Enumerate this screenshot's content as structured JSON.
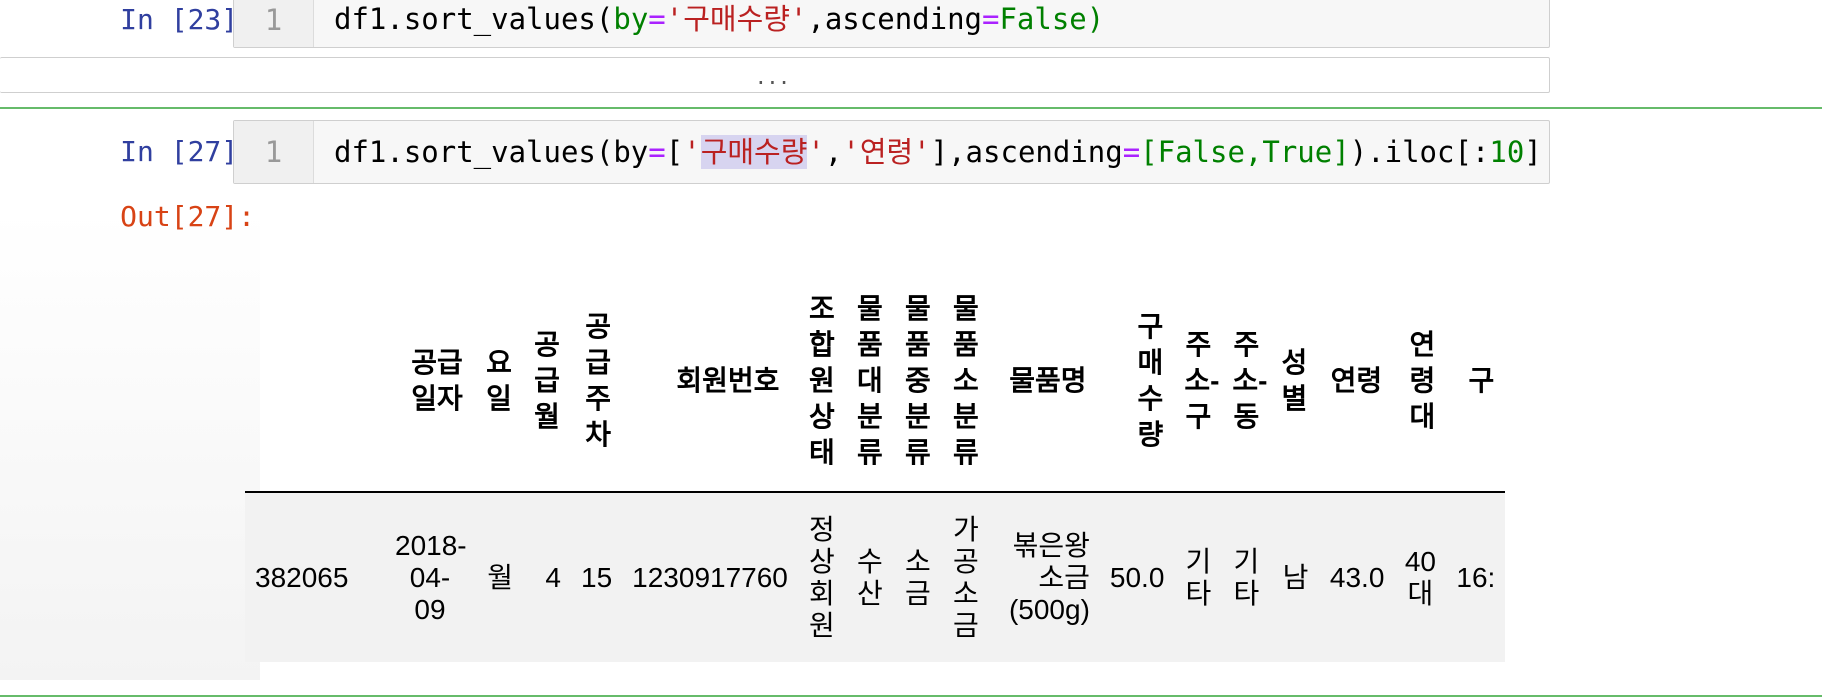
{
  "cells": {
    "cell23": {
      "prompt": "In [23]:",
      "line_no": "1",
      "code": {
        "p1": "df1.sort_values(",
        "p2": "by",
        "p3": "=",
        "p4": "'구매수량'",
        "p5": ",ascending",
        "p6": "=",
        "p7": "False",
        "p8": ")"
      }
    },
    "collapsed_output": "...",
    "cell27": {
      "prompt": "In [27]:",
      "out_prompt": "Out[27]:",
      "line_no": "1",
      "code": {
        "p1": "df1.sort_values(by",
        "p2": "=",
        "p3": "[",
        "p4": "'구매수량'",
        "p5": ",",
        "p6": "'연령'",
        "p7": "],ascending",
        "p8": "=",
        "p9": "[False,True]",
        "p10": ").iloc[:",
        "p11": "10",
        "p12": "]"
      }
    }
  },
  "dataframe": {
    "columns": [
      "공급일자",
      "요일",
      "공급월",
      "공급주차",
      "회원번호",
      "조합원상태",
      "물품대분류",
      "물품중분류",
      "물품소분류",
      "물품명",
      "구매수량",
      "주소-구",
      "주소-동",
      "성별",
      "연령",
      "연령대",
      "구"
    ],
    "rows": [
      {
        "index": "382065",
        "공급일자": "2018-04-09",
        "요일": "월",
        "공급월": "4",
        "공급주차": "15",
        "회원번호": "1230917760",
        "조합원상태": "정상회원",
        "물품대분류": "수산",
        "물품중분류": "소금",
        "물품소분류": "가공소금",
        "물품명": "볶은왕소금(500g)",
        "구매수량": "50.0",
        "주소-구": "기타",
        "주소-동": "기타",
        "성별": "남",
        "연령": "43.0",
        "연령대": "40대",
        "구": "16:"
      }
    ]
  }
}
